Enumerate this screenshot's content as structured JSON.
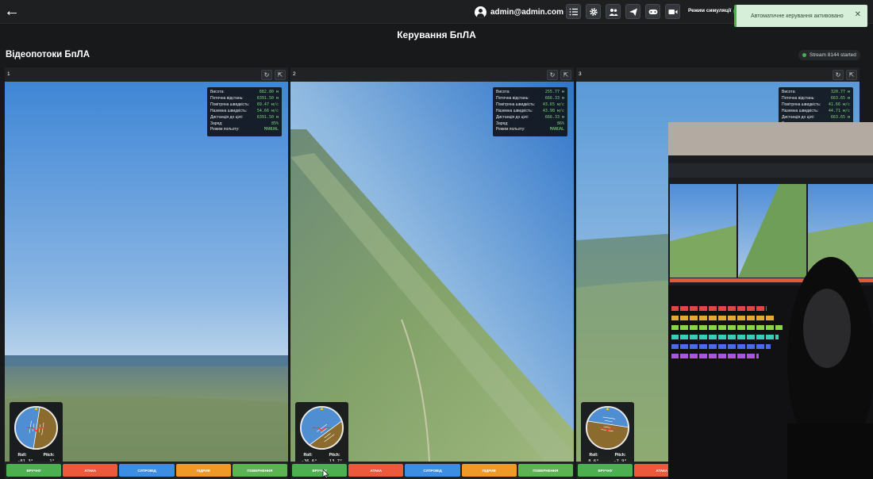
{
  "header": {
    "user_email": "admin@admin.com",
    "simulation_label": "Режим симуляції",
    "toolbar_icons": [
      "list-icon",
      "gear-icon",
      "users-icon",
      "send-icon",
      "gamepad-icon",
      "video-camera-icon"
    ]
  },
  "toast": {
    "message": "Автоматичне керування активовано",
    "close": "✕"
  },
  "page_title": "Керування БпЛА",
  "section_title": "Відеопотоки БпЛА",
  "stream_status": "Stream 8144 started",
  "telemetry_labels": [
    "Висота:",
    "Поточна відстань:",
    "Повітряна швидкість:",
    "Наземна швидкість:",
    "Дистанція до цілі:",
    "Заряд:",
    "Режим польоту:"
  ],
  "attitude_labels": {
    "roll": "Roll:",
    "pitch": "Pitch:"
  },
  "mode_buttons": [
    "ВРУЧНУ",
    "АТАКА",
    "СУПРОВІД",
    "ПІДРИВ",
    "ПОВЕРНЕННЯ"
  ],
  "panels": [
    {
      "id": "1",
      "telemetry": [
        "882.80 м",
        "6391.50 м",
        "69.47 м/с",
        "54.66 м/с",
        "6391.50 м",
        "85%",
        "MANUAL"
      ],
      "roll": "-81.3°",
      "pitch": "1°",
      "roll_deg": -81.3,
      "pitch_deg": 1
    },
    {
      "id": "2",
      "telemetry": [
        "255.77 м",
        "666.33 м",
        "43.65 м/с",
        "43.98 м/с",
        "666.33 м",
        "86%",
        "MANUAL"
      ],
      "roll": "-36.6°",
      "pitch": "13.7°",
      "roll_deg": -36.6,
      "pitch_deg": 13.7
    },
    {
      "id": "3",
      "telemetry": [
        "320.77 м",
        "663.65 м",
        "41.66 м/с",
        "44.71 м/с",
        "663.65 м",
        "",
        ""
      ],
      "roll": "8.6°",
      "pitch": "-7.9°",
      "roll_deg": 8.6,
      "pitch_deg": -7.9
    }
  ]
}
